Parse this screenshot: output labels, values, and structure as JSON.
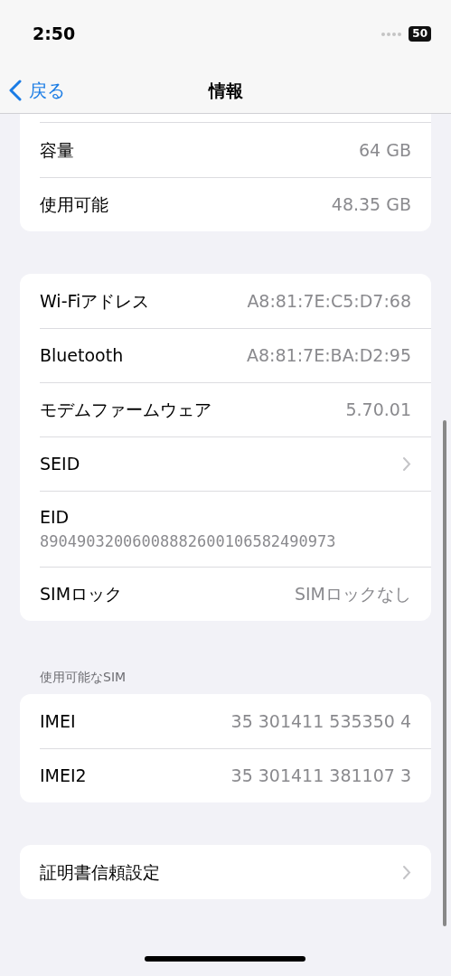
{
  "status_bar": {
    "time": "2:50",
    "battery": "50"
  },
  "nav": {
    "back": "戻る",
    "title": "情報"
  },
  "groups": [
    {
      "cut_top": true,
      "rows": [
        {
          "kind": "value",
          "label": "容量",
          "value": "64 GB"
        },
        {
          "kind": "value",
          "label": "使用可能",
          "value": "48.35 GB"
        }
      ]
    },
    {
      "rows": [
        {
          "kind": "value",
          "label": "Wi-Fiアドレス",
          "value": "A8:81:7E:C5:D7:68"
        },
        {
          "kind": "value",
          "label": "Bluetooth",
          "value": "A8:81:7E:BA:D2:95"
        },
        {
          "kind": "value",
          "label": "モデムファームウェア",
          "value": "5.70.01"
        },
        {
          "kind": "chevron",
          "label": "SEID"
        },
        {
          "kind": "stacked",
          "label": "EID",
          "value": "89049032006008882600106582490973"
        },
        {
          "kind": "value",
          "label": "SIMロック",
          "value": "SIMロックなし"
        }
      ]
    },
    {
      "header": "使用可能なSIM",
      "rows": [
        {
          "kind": "value",
          "label": "IMEI",
          "value": "35 301411 535350 4"
        },
        {
          "kind": "value",
          "label": "IMEI2",
          "value": "35 301411 381107 3"
        }
      ]
    },
    {
      "rows": [
        {
          "kind": "chevron",
          "label": "証明書信頼設定"
        }
      ]
    }
  ]
}
